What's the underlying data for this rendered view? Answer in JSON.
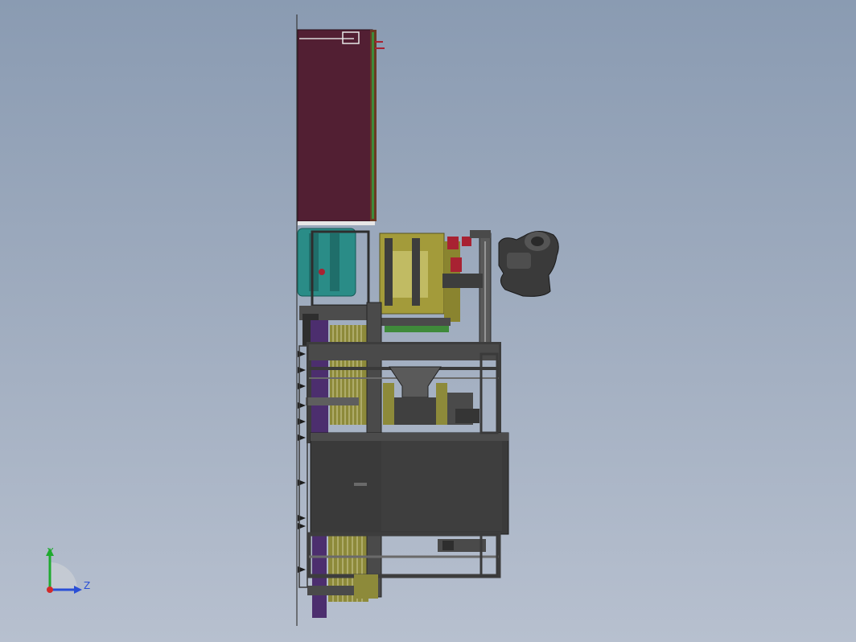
{
  "viewport": {
    "background_top": "#8a9bb2",
    "background_bottom": "#b7c0cf"
  },
  "model": {
    "hopper_color": "#521f33",
    "frame_color": "#3d3d3d",
    "frame_light": "#6a6a6a",
    "olive_color": "#a39b3a",
    "teal_color": "#2a8c87",
    "purple_color": "#4c2e6e",
    "red_accent": "#a82232",
    "green_accent": "#3f8a3a"
  },
  "triad": {
    "y_label": "Y",
    "z_label": "Z",
    "y_color": "#1faa2f",
    "z_color": "#2a4fd6",
    "x_color": "#d22a2a"
  }
}
